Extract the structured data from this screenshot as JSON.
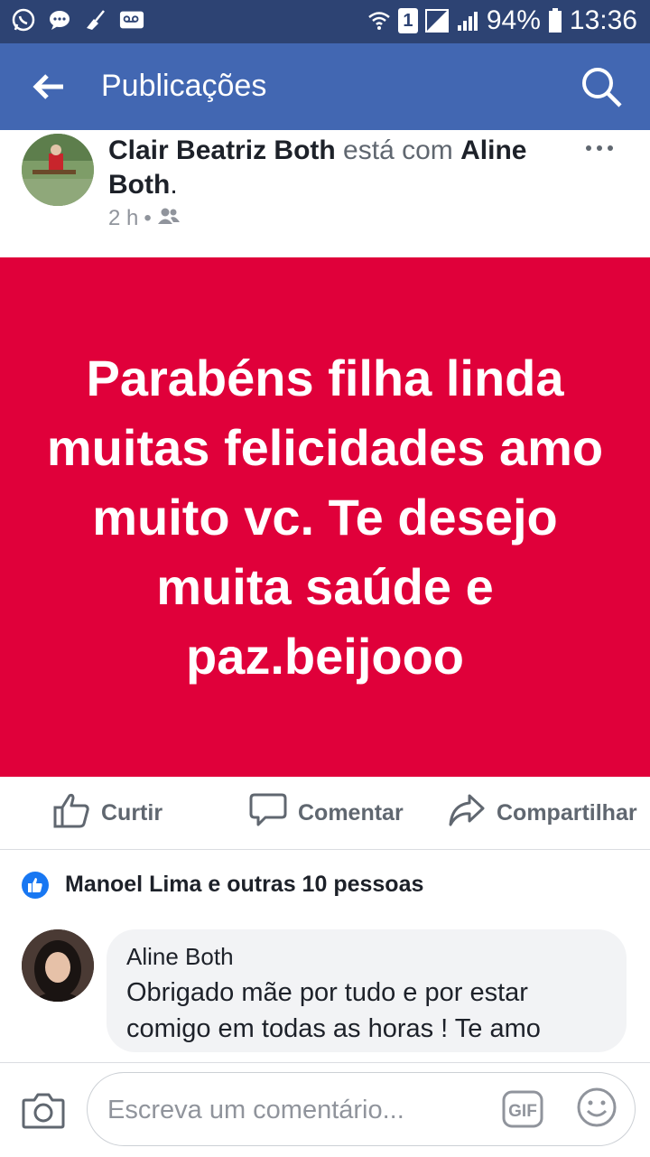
{
  "status_bar": {
    "battery": "94%",
    "time": "13:36",
    "sim_slot": "1",
    "left_icons": [
      "whatsapp-icon",
      "chat-icon",
      "broom-icon",
      "voicemail-icon"
    ],
    "right_icons": [
      "wifi-icon",
      "sim-icon",
      "signal-icon",
      "battery-icon"
    ]
  },
  "app_bar": {
    "title": "Publicações",
    "back_icon": "arrow-left-icon",
    "search_icon": "search-icon",
    "background": "#4267b2"
  },
  "post": {
    "author": "Clair Beatriz Both",
    "with_text": " está com ",
    "tagged": "Aline Both",
    "period": ".",
    "time": "2 h",
    "separator": " • ",
    "audience_icon": "friends-icon",
    "text": "Parabéns filha linda muitas felicidades amo muito vc. Te desejo muita saúde e paz.beijooo",
    "background_color": "#e0003a"
  },
  "actions": {
    "like": "Curtir",
    "comment": "Comentar",
    "share": "Compartilhar"
  },
  "reactions": {
    "summary": "Manoel Lima e outras 10 pessoas",
    "icon": "like-icon"
  },
  "comment": {
    "author": "Aline Both",
    "text": "Obrigado mãe por tudo e por estar comigo em todas as horas ! Te amo"
  },
  "composer": {
    "placeholder": "Escreva um comentário...",
    "gif_label": "GIF",
    "camera_icon": "camera-icon",
    "emoji_icon": "emoji-icon"
  }
}
